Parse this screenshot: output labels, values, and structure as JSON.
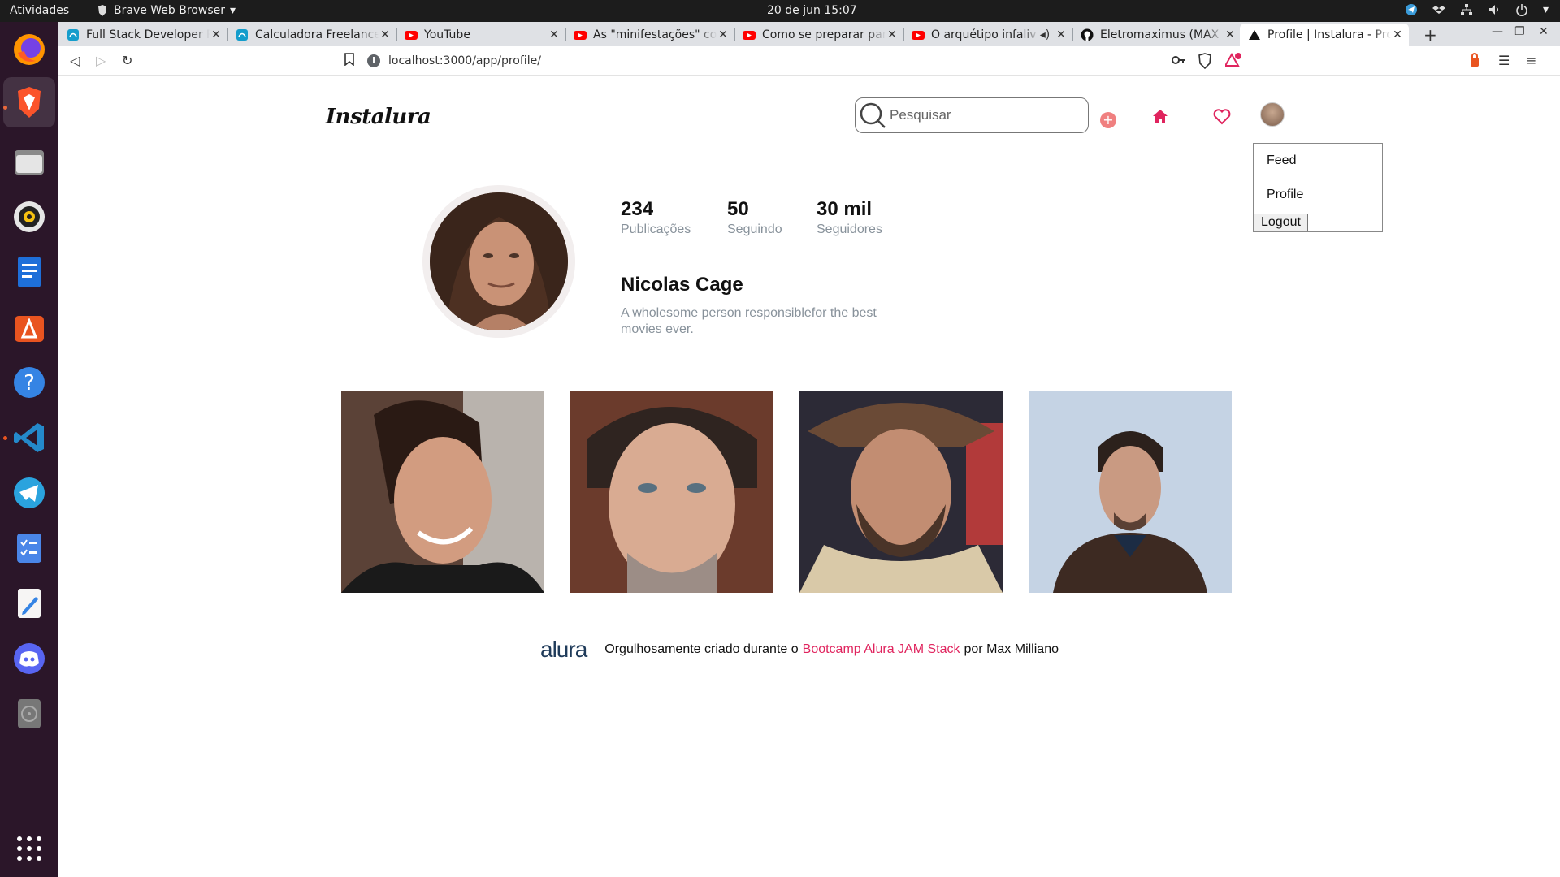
{
  "os": {
    "activities": "Atividades",
    "app_menu": "Brave Web Browser",
    "clock": "20 de jun  15:07"
  },
  "tabs": [
    {
      "title": "Full Stack Developer R",
      "icon": "mobirise-icon"
    },
    {
      "title": "Calculadora Freelance",
      "icon": "mobirise-icon"
    },
    {
      "title": "YouTube",
      "icon": "youtube-icon"
    },
    {
      "title": "As \"minifestações\" co",
      "icon": "youtube-icon"
    },
    {
      "title": "Como se preparar para",
      "icon": "youtube-icon"
    },
    {
      "title": "O arquétipo infaliv",
      "icon": "youtube-icon"
    },
    {
      "title": "Eletromaximus (MAX",
      "icon": "github-icon"
    },
    {
      "title": "Profile | Instalura - Pro",
      "icon": "triangle-icon"
    }
  ],
  "url": "localhost:3000/app/profile/",
  "header": {
    "logo": "Instalura",
    "search_placeholder": "Pesquisar"
  },
  "menu": {
    "feed": "Feed",
    "profile": "Profile",
    "logout": "Logout"
  },
  "profile": {
    "stats": [
      {
        "value": "234",
        "label": "Publicações"
      },
      {
        "value": "50",
        "label": "Seguindo"
      },
      {
        "value": "30 mil",
        "label": "Seguidores"
      }
    ],
    "name": "Nicolas Cage",
    "bio": "A wholesome person responsiblefor the best movies ever."
  },
  "footer": {
    "brand": "alura",
    "text_before": "Orgulhosamente criado durante o",
    "link": "Bootcamp Alura JAM Stack",
    "text_after": "por Max Milliano"
  },
  "colors": {
    "accent": "#e0245e",
    "muted": "#88929b",
    "dock": "#2b1629"
  }
}
